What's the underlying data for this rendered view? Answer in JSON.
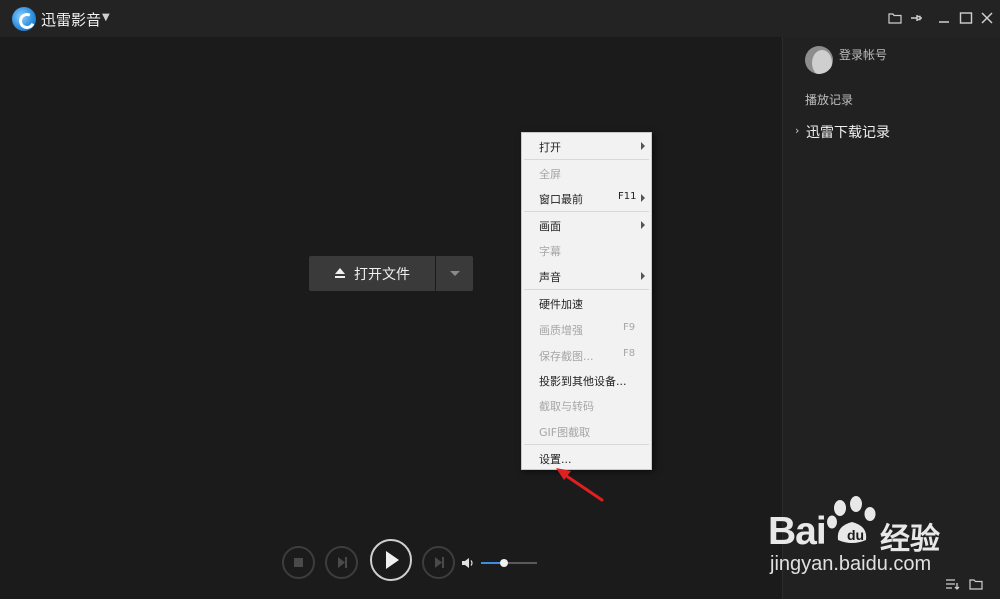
{
  "app": {
    "title": "迅雷影音"
  },
  "sidebar": {
    "login": "登录帐号",
    "history": "播放记录",
    "download_history": "迅雷下载记录"
  },
  "player": {
    "open_file": "打开文件",
    "volume_level": 0.41
  },
  "context_menu": {
    "items": [
      {
        "label": "打开",
        "shortcut": "",
        "submenu": true,
        "enabled": true
      },
      {
        "label": "全屏",
        "shortcut": "",
        "submenu": false,
        "enabled": false
      },
      {
        "label": "窗口最前",
        "shortcut": "F11",
        "submenu": true,
        "enabled": true
      },
      {
        "label": "画面",
        "shortcut": "",
        "submenu": true,
        "enabled": true
      },
      {
        "label": "字幕",
        "shortcut": "",
        "submenu": false,
        "enabled": false
      },
      {
        "label": "声音",
        "shortcut": "",
        "submenu": true,
        "enabled": true
      },
      {
        "label": "硬件加速",
        "shortcut": "",
        "submenu": false,
        "enabled": true
      },
      {
        "label": "画质增强",
        "shortcut": "F9",
        "submenu": false,
        "enabled": false
      },
      {
        "label": "保存截图...",
        "shortcut": "F8",
        "submenu": false,
        "enabled": false
      },
      {
        "label": "投影到其他设备...",
        "shortcut": "",
        "submenu": false,
        "enabled": true
      },
      {
        "label": "截取与转码",
        "shortcut": "",
        "submenu": false,
        "enabled": false
      },
      {
        "label": "GIF图截取",
        "shortcut": "",
        "submenu": false,
        "enabled": false
      },
      {
        "label": "设置...",
        "shortcut": "",
        "submenu": false,
        "enabled": true
      }
    ]
  },
  "watermark": {
    "brand": "Bai",
    "suffix": "经验",
    "url": "jingyan.baidu.com"
  },
  "colors": {
    "accent": "#3a8ee6",
    "annotation": "#e02020"
  }
}
